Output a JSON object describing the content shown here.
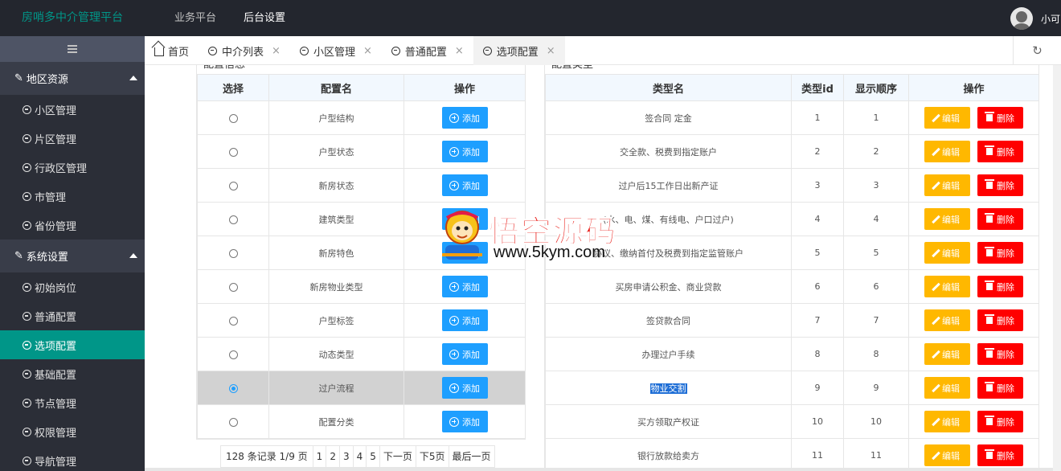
{
  "header": {
    "logo": "房哨多中介管理平台",
    "nav": [
      {
        "label": "业务平台",
        "active": false
      },
      {
        "label": "后台设置",
        "active": true
      }
    ],
    "username": "小可"
  },
  "sidebar": {
    "groups": [
      {
        "label": "地区资源",
        "icon": "wrench-icon",
        "expanded": true,
        "items": [
          {
            "label": "小区管理",
            "active": false
          },
          {
            "label": "片区管理",
            "active": false
          },
          {
            "label": "行政区管理",
            "active": false
          },
          {
            "label": "市管理",
            "active": false
          },
          {
            "label": "省份管理",
            "active": false
          }
        ]
      },
      {
        "label": "系统设置",
        "icon": "wrench-icon",
        "expanded": true,
        "items": [
          {
            "label": "初始岗位",
            "active": false
          },
          {
            "label": "普通配置",
            "active": false
          },
          {
            "label": "选项配置",
            "active": true
          },
          {
            "label": "基础配置",
            "active": false
          },
          {
            "label": "节点管理",
            "active": false
          },
          {
            "label": "权限管理",
            "active": false
          },
          {
            "label": "导航管理",
            "active": false
          }
        ]
      }
    ]
  },
  "tabs": [
    {
      "label": "首页",
      "icon": "home-icon",
      "closable": false,
      "active": false
    },
    {
      "label": "中介列表",
      "icon": "circle-icon",
      "closable": true,
      "active": false
    },
    {
      "label": "小区管理",
      "icon": "circle-icon",
      "closable": true,
      "active": false
    },
    {
      "label": "普通配置",
      "icon": "circle-icon",
      "closable": true,
      "active": false
    },
    {
      "label": "选项配置",
      "icon": "circle-icon",
      "closable": true,
      "active": true
    }
  ],
  "left_panel": {
    "title": "配置信息",
    "columns": [
      "选择",
      "配置名",
      "操作"
    ],
    "add_label": "添加",
    "rows": [
      {
        "name": "户型结构",
        "selected": false
      },
      {
        "name": "户型状态",
        "selected": false
      },
      {
        "name": "新房状态",
        "selected": false
      },
      {
        "name": "建筑类型",
        "selected": false
      },
      {
        "name": "新房特色",
        "selected": false
      },
      {
        "name": "新房物业类型",
        "selected": false
      },
      {
        "name": "户型标签",
        "selected": false
      },
      {
        "name": "动态类型",
        "selected": false
      },
      {
        "name": "过户流程",
        "selected": true
      },
      {
        "name": "配置分类",
        "selected": false
      }
    ],
    "pager": {
      "summary": "128 条记录 1/9 页",
      "pages": [
        "1",
        "2",
        "3",
        "4",
        "5"
      ],
      "next": "下一页",
      "next5": "下5页",
      "last": "最后一页"
    }
  },
  "right_panel": {
    "title": "配置类型",
    "columns": [
      "类型名",
      "类型id",
      "显示顺序",
      "操作"
    ],
    "edit_label": "编辑",
    "delete_label": "删除",
    "rows": [
      {
        "name": "签合同 定金",
        "id": "1",
        "order": "1",
        "highlighted": false
      },
      {
        "name": "交全款、税费到指定账户",
        "id": "2",
        "order": "2",
        "highlighted": false
      },
      {
        "name": "过户后15工作日出新产证",
        "id": "3",
        "order": "3",
        "highlighted": false
      },
      {
        "name": "(水、电、煤、有线电、户口过户)",
        "id": "4",
        "order": "4",
        "highlighted": false
      },
      {
        "name": "协议、缴纳首付及税费到指定监管账户",
        "id": "5",
        "order": "5",
        "highlighted": false
      },
      {
        "name": "买房申请公积金、商业贷款",
        "id": "6",
        "order": "6",
        "highlighted": false
      },
      {
        "name": "签贷款合同",
        "id": "7",
        "order": "7",
        "highlighted": false
      },
      {
        "name": "办理过户手续",
        "id": "8",
        "order": "8",
        "highlighted": false
      },
      {
        "name": "物业交割",
        "id": "9",
        "order": "9",
        "highlighted": true
      },
      {
        "name": "买方领取产权证",
        "id": "10",
        "order": "10",
        "highlighted": false
      },
      {
        "name": "银行放款给卖方",
        "id": "11",
        "order": "11",
        "highlighted": false
      }
    ]
  },
  "watermark": {
    "title": "悟空源码",
    "url": "www.5kym.com"
  }
}
